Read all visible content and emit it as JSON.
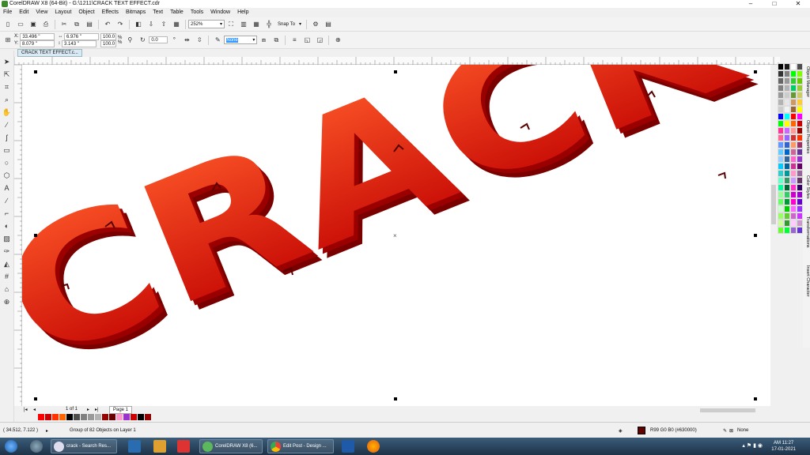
{
  "window": {
    "title": "CorelDRAW X8 (64-Bit) - G:\\1211\\CRACK TEXT EFFECT.cdr"
  },
  "menu": [
    "File",
    "Edit",
    "View",
    "Layout",
    "Object",
    "Effects",
    "Bitmaps",
    "Text",
    "Table",
    "Tools",
    "Window",
    "Help"
  ],
  "toolbar": {
    "zoom": "252%",
    "snap": "Snap To"
  },
  "property_bar": {
    "x": "33.496 \"",
    "y": "8.079 \"",
    "width": "6.976 \"",
    "height": "3.143 \"",
    "scale_w": "100.0",
    "scale_h": "100.0",
    "pct": "%",
    "angle": "0.0",
    "outline": "None"
  },
  "document_tab": "CRACK TEXT EFFECT.c...",
  "canvas": {
    "artwork_text": "CRACK"
  },
  "page_nav": {
    "count": "1 of 1",
    "page_tab": "Page 1"
  },
  "dockers": [
    "Object Manager",
    "Object Properties",
    "Color Styles",
    "Transformations",
    "Insert Character"
  ],
  "status": {
    "cursor": "( 34.512, 7.122 )",
    "selection": "Group of 82 Objects on Layer 1",
    "fill_label": "R99 G0 B0 (#630000)",
    "outline_label": "None"
  },
  "taskbar": {
    "items": [
      "crack - Search Res...",
      "CorelDRAW X8 (6...",
      "Edit Post - Design ..."
    ],
    "time": "AM 11:27",
    "date": "17-01-2021"
  },
  "colors": {
    "fill": "#630000",
    "text_top": "#ff5a2a",
    "text_bottom": "#c00000",
    "extrude": "#7a0000"
  },
  "palette_colors": [
    "#000000",
    "#1a1a1a",
    "#ffffff",
    "#4d4d4d",
    "#333333",
    "#808080",
    "#00ff00",
    "#80ff00",
    "#666666",
    "#999999",
    "#33cc33",
    "#66cc00",
    "#808080",
    "#b3b3b3",
    "#00cc66",
    "#99cc33",
    "#999999",
    "#cccccc",
    "#669933",
    "#cccc66",
    "#b3b3b3",
    "#e6e6e6",
    "#cc9966",
    "#ffcc33",
    "#cccccc",
    "#f2f2f2",
    "#996633",
    "#ffff00",
    "#0000ff",
    "#00ffff",
    "#ff0000",
    "#ff00ff",
    "#00ff00",
    "#ffff00",
    "#ff6600",
    "#cc0000",
    "#ff3399",
    "#cc66ff",
    "#ff9999",
    "#990000",
    "#ff6699",
    "#9966ff",
    "#cc3333",
    "#ff3300",
    "#6699ff",
    "#3366cc",
    "#ff9966",
    "#993366",
    "#66ccff",
    "#0066cc",
    "#cc6699",
    "#663399",
    "#99ccff",
    "#336699",
    "#ff66cc",
    "#9933cc",
    "#00ccff",
    "#006699",
    "#cc3399",
    "#660066",
    "#33cccc",
    "#009999",
    "#ff99cc",
    "#996699",
    "#66ffcc",
    "#339966",
    "#cc99ff",
    "#663366",
    "#00ff99",
    "#006633",
    "#ff33cc",
    "#330066",
    "#99ff99",
    "#33cc66",
    "#cc00cc",
    "#9900cc",
    "#66ff66",
    "#009933",
    "#ff00cc",
    "#6600cc",
    "#ccffcc",
    "#00cc00",
    "#ff66ff",
    "#9933ff",
    "#99ff66",
    "#66cc33",
    "#cc66cc",
    "#cc33ff",
    "#ccff99",
    "#339933",
    "#ffccff",
    "#cc99cc",
    "#66ff33",
    "#00ff33",
    "#9966cc",
    "#6633cc"
  ],
  "doc_palette": [
    "#ff0000",
    "#cc0000",
    "#ff3300",
    "#ff6600",
    "#000000",
    "#4d4d4d",
    "#808080",
    "#999999",
    "#b3b3b3",
    "#990000",
    "#660000",
    "#ff99cc",
    "#9933cc",
    "#cc0000",
    "#000000",
    "#990000"
  ]
}
